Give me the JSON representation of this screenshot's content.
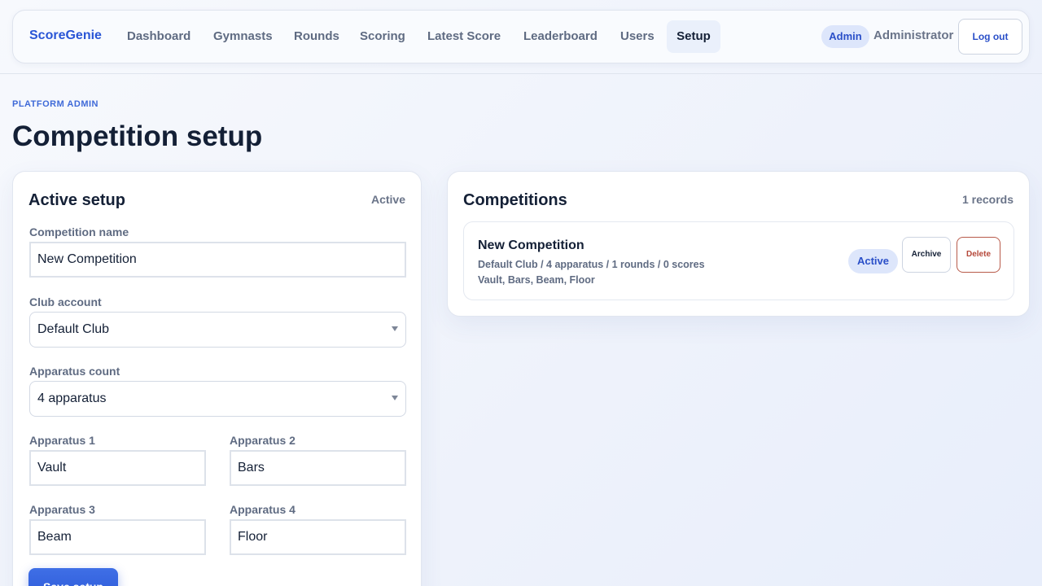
{
  "nav": {
    "brand": "ScoreGenie",
    "links": [
      "Dashboard",
      "Gymnasts",
      "Rounds",
      "Scoring",
      "Latest Score",
      "Leaderboard",
      "Users",
      "Setup"
    ],
    "active": "Setup",
    "role_badge": "Admin",
    "user_name": "Administrator",
    "logout_label": "Log out"
  },
  "page": {
    "eyebrow": "PLATFORM ADMIN",
    "title": "Competition setup"
  },
  "setup_card": {
    "title": "Active setup",
    "status": "Active",
    "competition_name_label": "Competition name",
    "competition_name_value": "New Competition",
    "club_label": "Club account",
    "club_value": "Default Club",
    "apparatus_count_label": "Apparatus count",
    "apparatus_count_value": "4 apparatus",
    "apparatus": [
      {
        "label": "Apparatus 1",
        "value": "Vault"
      },
      {
        "label": "Apparatus 2",
        "value": "Bars"
      },
      {
        "label": "Apparatus 3",
        "value": "Beam"
      },
      {
        "label": "Apparatus 4",
        "value": "Floor"
      }
    ],
    "save_label": "Save setup"
  },
  "competitions_card": {
    "title": "Competitions",
    "count": "1 records",
    "items": [
      {
        "name": "New Competition",
        "summary": "Default Club / 4 apparatus / 1 rounds / 0 scores",
        "apparatus_list": "Vault, Bars, Beam, Floor",
        "status": "Active",
        "archive_label": "Archive",
        "delete_label": "Delete"
      }
    ]
  },
  "colors": {
    "accent": "#2a56d6",
    "badge_bg": "#dde6fb",
    "danger": "#b5483a",
    "text": "#142036",
    "muted": "#5f6b82"
  }
}
